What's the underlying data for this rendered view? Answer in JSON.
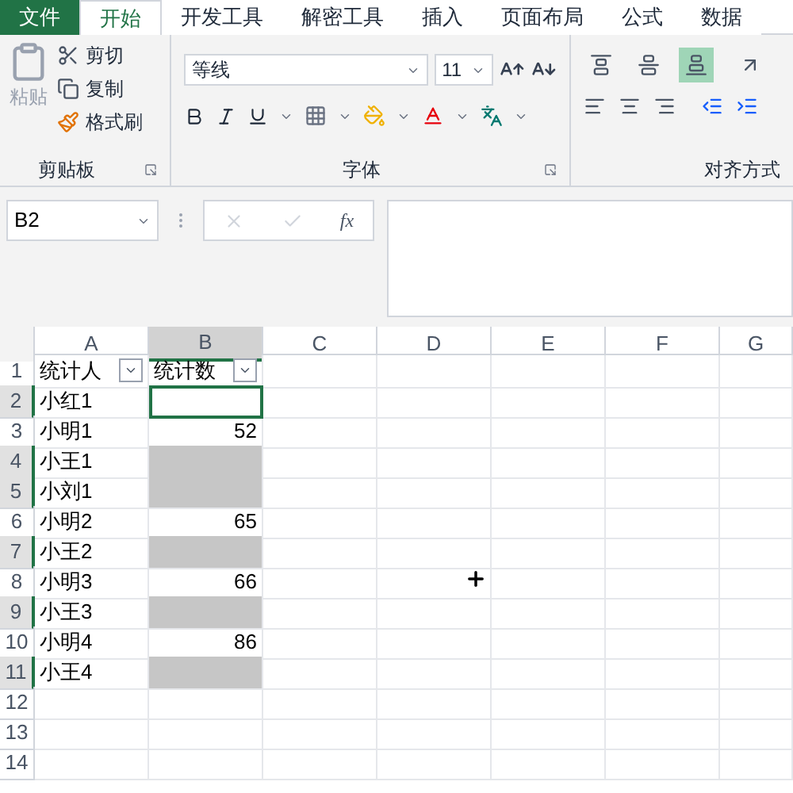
{
  "tabs": [
    {
      "label": "文件",
      "kind": "file",
      "selected": false
    },
    {
      "label": "开始",
      "kind": "tab",
      "selected": true
    },
    {
      "label": "开发工具",
      "kind": "tab",
      "selected": false
    },
    {
      "label": "解密工具",
      "kind": "tab",
      "selected": false
    },
    {
      "label": "插入",
      "kind": "tab",
      "selected": false
    },
    {
      "label": "页面布局",
      "kind": "tab",
      "selected": false
    },
    {
      "label": "公式",
      "kind": "tab",
      "selected": false
    },
    {
      "label": "数据",
      "kind": "tab",
      "selected": false
    }
  ],
  "clipboard": {
    "paste": "粘贴",
    "cut": "剪切",
    "copy": "复制",
    "format_painter": "格式刷",
    "group": "剪贴板"
  },
  "font": {
    "name": "等线",
    "size": "11",
    "group": "字体"
  },
  "alignment": {
    "group": "对齐方式",
    "vertical": [
      {
        "selected": false
      },
      {
        "selected": false
      },
      {
        "selected": true
      }
    ]
  },
  "name_box": "B2",
  "formula_fx": "fx",
  "columns": [
    {
      "label": "A",
      "selected": false
    },
    {
      "label": "B",
      "selected": true
    },
    {
      "label": "C",
      "selected": false
    },
    {
      "label": "D",
      "selected": false
    },
    {
      "label": "E",
      "selected": false
    },
    {
      "label": "F",
      "selected": false
    },
    {
      "label": "G",
      "selected": false
    }
  ],
  "rows": [
    {
      "number": "1",
      "selected": false,
      "cells": [
        {
          "text": "统计人",
          "kind": "header",
          "selected": false,
          "active": false
        },
        {
          "text": "统计数",
          "kind": "header",
          "selected": false,
          "active": false
        }
      ]
    },
    {
      "number": "2",
      "selected": true,
      "cells": [
        {
          "text": "小红1",
          "kind": "text",
          "selected": false,
          "active": false
        },
        {
          "text": "",
          "kind": "number",
          "selected": true,
          "active": true
        }
      ]
    },
    {
      "number": "3",
      "selected": false,
      "cells": [
        {
          "text": "小明1",
          "kind": "text",
          "selected": false,
          "active": false
        },
        {
          "text": "52",
          "kind": "number",
          "selected": false,
          "active": false
        }
      ]
    },
    {
      "number": "4",
      "selected": true,
      "cells": [
        {
          "text": "小王1",
          "kind": "text",
          "selected": false,
          "active": false
        },
        {
          "text": "",
          "kind": "number",
          "selected": true,
          "active": false
        }
      ]
    },
    {
      "number": "5",
      "selected": true,
      "cells": [
        {
          "text": "小刘1",
          "kind": "text",
          "selected": false,
          "active": false
        },
        {
          "text": "",
          "kind": "number",
          "selected": true,
          "active": false
        }
      ]
    },
    {
      "number": "6",
      "selected": false,
      "cells": [
        {
          "text": "小明2",
          "kind": "text",
          "selected": false,
          "active": false
        },
        {
          "text": "65",
          "kind": "number",
          "selected": false,
          "active": false
        }
      ]
    },
    {
      "number": "7",
      "selected": true,
      "cells": [
        {
          "text": "小王2",
          "kind": "text",
          "selected": false,
          "active": false
        },
        {
          "text": "",
          "kind": "number",
          "selected": true,
          "active": false
        }
      ]
    },
    {
      "number": "8",
      "selected": false,
      "cells": [
        {
          "text": "小明3",
          "kind": "text",
          "selected": false,
          "active": false
        },
        {
          "text": "66",
          "kind": "number",
          "selected": false,
          "active": false
        }
      ]
    },
    {
      "number": "9",
      "selected": true,
      "cells": [
        {
          "text": "小王3",
          "kind": "text",
          "selected": false,
          "active": false
        },
        {
          "text": "",
          "kind": "number",
          "selected": true,
          "active": false
        }
      ]
    },
    {
      "number": "10",
      "selected": false,
      "cells": [
        {
          "text": "小明4",
          "kind": "text",
          "selected": false,
          "active": false
        },
        {
          "text": "86",
          "kind": "number",
          "selected": false,
          "active": false
        }
      ]
    },
    {
      "number": "11",
      "selected": true,
      "cells": [
        {
          "text": "小王4",
          "kind": "text",
          "selected": false,
          "active": false
        },
        {
          "text": "",
          "kind": "number",
          "selected": true,
          "active": false
        }
      ]
    },
    {
      "number": "12",
      "selected": false,
      "cells": []
    },
    {
      "number": "13",
      "selected": false,
      "cells": []
    },
    {
      "number": "14",
      "selected": false,
      "cells": []
    }
  ]
}
